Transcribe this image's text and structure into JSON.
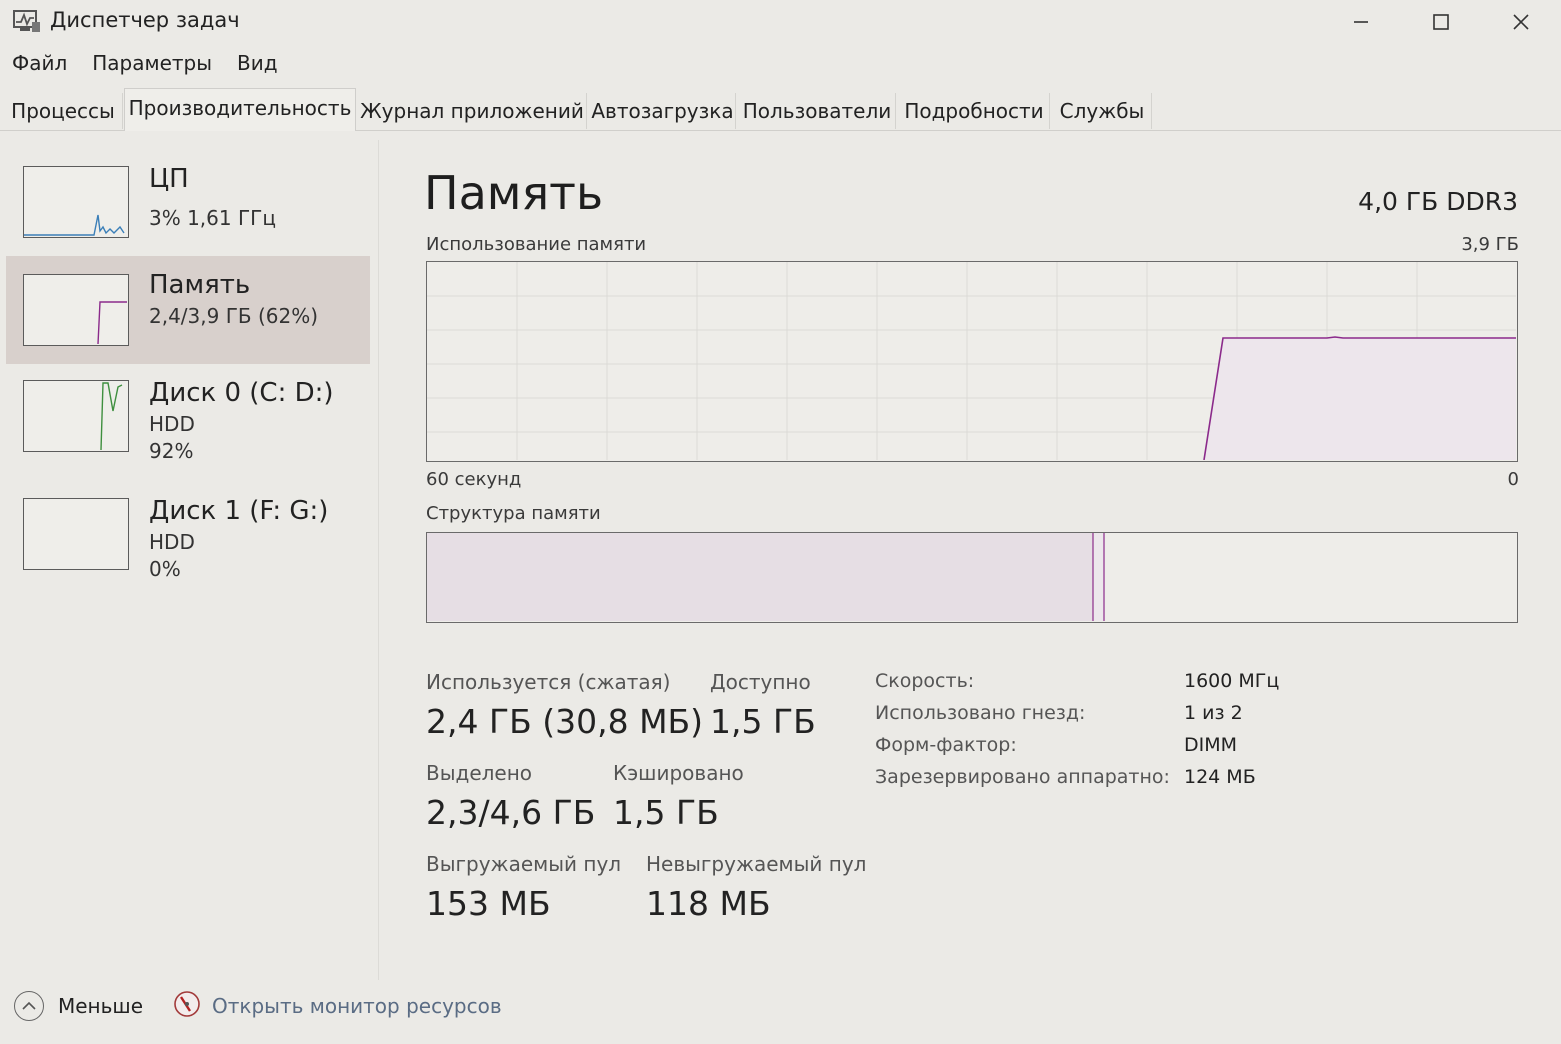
{
  "window": {
    "title": "Диспетчер задач"
  },
  "menu": [
    "Файл",
    "Параметры",
    "Вид"
  ],
  "tabs": [
    "Процессы",
    "Производительность",
    "Журнал приложений",
    "Автозагрузка",
    "Пользователи",
    "Подробности",
    "Службы"
  ],
  "sidebar": [
    {
      "title": "ЦП",
      "line1": "3% 1,61 ГГц",
      "line2": ""
    },
    {
      "title": "Память",
      "line1": "2,4/3,9 ГБ (62%)",
      "line2": ""
    },
    {
      "title": "Диск 0 (C: D:)",
      "line1": "HDD",
      "line2": "92%"
    },
    {
      "title": "Диск 1 (F: G:)",
      "line1": "HDD",
      "line2": "0%"
    }
  ],
  "main": {
    "title": "Память",
    "spec": "4,0 ГБ DDR3",
    "usage_label": "Использование памяти",
    "usage_max": "3,9 ГБ",
    "axis_left": "60 секунд",
    "axis_right": "0",
    "structure_label": "Структура памяти"
  },
  "stats": {
    "in_use_label": "Используется (сжатая)",
    "in_use_value": "2,4 ГБ (30,8 МБ)",
    "available_label": "Доступно",
    "available_value": "1,5 ГБ",
    "committed_label": "Выделено",
    "committed_value": "2,3/4,6 ГБ",
    "cached_label": "Кэшировано",
    "cached_value": "1,5 ГБ",
    "paged_label": "Выгружаемый пул",
    "paged_value": "153 МБ",
    "nonpaged_label": "Невыгружаемый пул",
    "nonpaged_value": "118 МБ"
  },
  "specs": [
    {
      "label": "Скорость:",
      "value": "1600 МГц"
    },
    {
      "label": "Использовано гнезд:",
      "value": "1 из 2"
    },
    {
      "label": "Форм-фактор:",
      "value": "DIMM"
    },
    {
      "label": "Зарезервировано аппаратно:",
      "value": "124 МБ"
    }
  ],
  "footer": {
    "fewer_label": "Меньше",
    "resmon_label": "Открыть монитор ресурсов"
  },
  "colors": {
    "memory_accent": "#8b2a8b",
    "selected_bg": "#d8d0cc"
  },
  "icons": [
    "task-manager-icon",
    "minimize-icon",
    "maximize-icon",
    "close-icon",
    "chevron-up-icon",
    "resource-monitor-icon"
  ]
}
